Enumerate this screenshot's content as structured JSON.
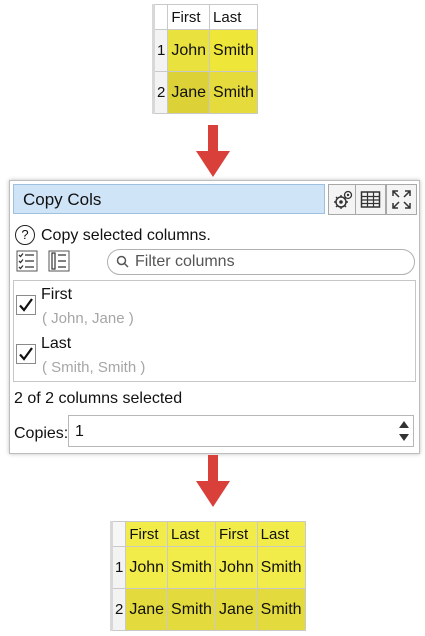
{
  "input_table": {
    "headers": [
      "First",
      "Last"
    ],
    "rows": [
      {
        "num": "1",
        "cells": [
          "John",
          "Smith"
        ]
      },
      {
        "num": "2",
        "cells": [
          "Jane",
          "Smith"
        ]
      }
    ]
  },
  "dialog": {
    "title": "Copy Cols",
    "description": "Copy selected columns.",
    "search_placeholder": "Filter columns",
    "columns": [
      {
        "name": "First",
        "values": "( John, Jane )",
        "checked": true
      },
      {
        "name": "Last",
        "values": "( Smith, Smith )",
        "checked": true
      }
    ],
    "selection_status": "2 of 2 columns selected",
    "copies_label": "Copies:",
    "copies_value": "1"
  },
  "output_table": {
    "headers": [
      "First",
      "Last",
      "First",
      "Last"
    ],
    "rows": [
      {
        "num": "1",
        "cells": [
          "John",
          "Smith",
          "John",
          "Smith"
        ]
      },
      {
        "num": "2",
        "cells": [
          "Jane",
          "Smith",
          "Jane",
          "Smith"
        ]
      }
    ]
  },
  "colors": {
    "highlight": "#efe63a",
    "arrow": "#d9403a",
    "title_bar": "#cfe4f7"
  }
}
